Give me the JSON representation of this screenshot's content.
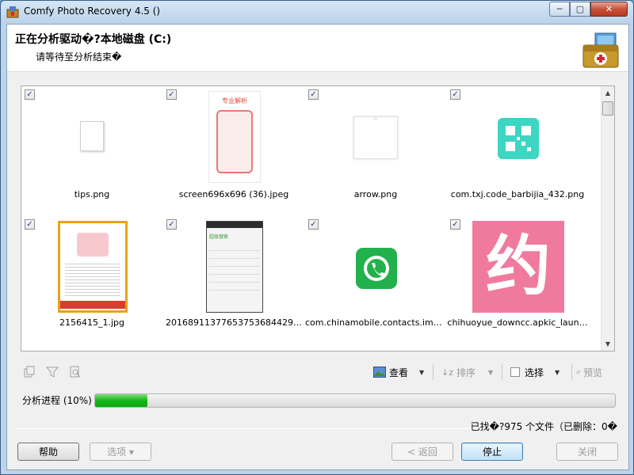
{
  "window": {
    "title": "Comfy Photo Recovery 4.5 ()",
    "controls": {
      "minimize": "─",
      "maximize": "▢",
      "close": "✕"
    }
  },
  "header": {
    "title": "正在分析驱动�?本地磁盘 (C:)",
    "subtitle": "请等待至分析结束�"
  },
  "files": [
    {
      "name": "tips.png",
      "checked": true,
      "checkmark": "✓",
      "icon": "blank-file-icon"
    },
    {
      "name": "screen696x696 (36).jpeg",
      "checked": true,
      "checkmark": "✓",
      "icon": "phone-screenshot-thumbnail",
      "thumb_text": "专业解析"
    },
    {
      "name": "arrow.png",
      "checked": true,
      "checkmark": "✓",
      "icon": "arrow-thumbnail"
    },
    {
      "name": "com.txj.code_barbijia_432.png",
      "checked": true,
      "checkmark": "✓",
      "icon": "qr-code-thumbnail"
    },
    {
      "name": "2156415_1.jpg",
      "checked": true,
      "checkmark": "✓",
      "icon": "article-thumbnail"
    },
    {
      "name": "20168911377653753684429…",
      "checked": true,
      "checkmark": "✓",
      "icon": "app-screenshot-thumbnail",
      "thumb_text": "超级搜索"
    },
    {
      "name": "com.chinamobile.contacts.im_7…",
      "checked": true,
      "checkmark": "✓",
      "icon": "green-phone-thumbnail"
    },
    {
      "name": "chihuoyue_downcc.apkic_laun…",
      "checked": true,
      "checkmark": "✓",
      "icon": "pink-logo-thumbnail",
      "thumb_text": "约"
    }
  ],
  "toolbar": {
    "view_label": "查看",
    "sort_label": "排序",
    "select_label": "选择",
    "preview_label": "预览",
    "dropdown_arrow": "▼"
  },
  "progress": {
    "label": "分析进程 (10%)",
    "percent": 10
  },
  "status": {
    "found_text": "已找�?975 个文件（已删除：0�"
  },
  "buttons": {
    "help": "帮助",
    "options": "选项 ▾",
    "back": "< 返回",
    "stop": "停止",
    "close": "关闭"
  },
  "colors": {
    "progress_green": "#16b616",
    "qr_teal": "#3dd6c3",
    "green_app": "#22b14c",
    "pink_logo": "#f07a9e",
    "title_bar": "#bcd3ea"
  }
}
